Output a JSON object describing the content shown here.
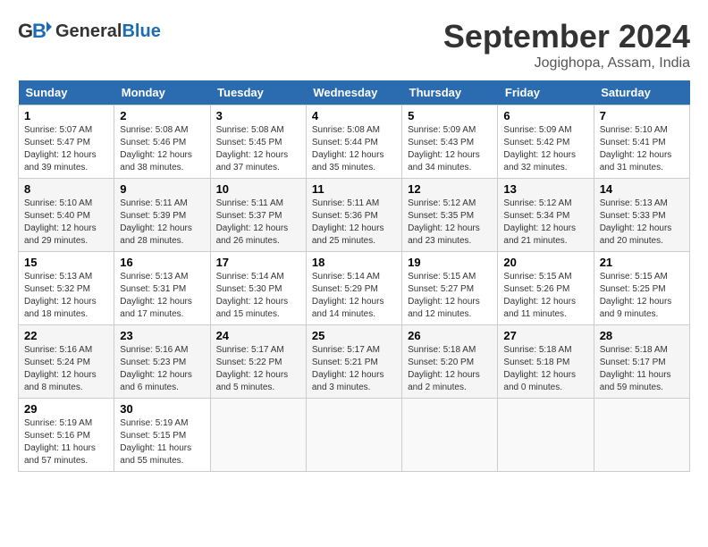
{
  "header": {
    "logo_line1": "General",
    "logo_line2": "Blue",
    "month": "September 2024",
    "location": "Jogighopa, Assam, India"
  },
  "weekdays": [
    "Sunday",
    "Monday",
    "Tuesday",
    "Wednesday",
    "Thursday",
    "Friday",
    "Saturday"
  ],
  "weeks": [
    [
      {
        "day": "1",
        "info": "Sunrise: 5:07 AM\nSunset: 5:47 PM\nDaylight: 12 hours\nand 39 minutes."
      },
      {
        "day": "2",
        "info": "Sunrise: 5:08 AM\nSunset: 5:46 PM\nDaylight: 12 hours\nand 38 minutes."
      },
      {
        "day": "3",
        "info": "Sunrise: 5:08 AM\nSunset: 5:45 PM\nDaylight: 12 hours\nand 37 minutes."
      },
      {
        "day": "4",
        "info": "Sunrise: 5:08 AM\nSunset: 5:44 PM\nDaylight: 12 hours\nand 35 minutes."
      },
      {
        "day": "5",
        "info": "Sunrise: 5:09 AM\nSunset: 5:43 PM\nDaylight: 12 hours\nand 34 minutes."
      },
      {
        "day": "6",
        "info": "Sunrise: 5:09 AM\nSunset: 5:42 PM\nDaylight: 12 hours\nand 32 minutes."
      },
      {
        "day": "7",
        "info": "Sunrise: 5:10 AM\nSunset: 5:41 PM\nDaylight: 12 hours\nand 31 minutes."
      }
    ],
    [
      {
        "day": "8",
        "info": "Sunrise: 5:10 AM\nSunset: 5:40 PM\nDaylight: 12 hours\nand 29 minutes."
      },
      {
        "day": "9",
        "info": "Sunrise: 5:11 AM\nSunset: 5:39 PM\nDaylight: 12 hours\nand 28 minutes."
      },
      {
        "day": "10",
        "info": "Sunrise: 5:11 AM\nSunset: 5:37 PM\nDaylight: 12 hours\nand 26 minutes."
      },
      {
        "day": "11",
        "info": "Sunrise: 5:11 AM\nSunset: 5:36 PM\nDaylight: 12 hours\nand 25 minutes."
      },
      {
        "day": "12",
        "info": "Sunrise: 5:12 AM\nSunset: 5:35 PM\nDaylight: 12 hours\nand 23 minutes."
      },
      {
        "day": "13",
        "info": "Sunrise: 5:12 AM\nSunset: 5:34 PM\nDaylight: 12 hours\nand 21 minutes."
      },
      {
        "day": "14",
        "info": "Sunrise: 5:13 AM\nSunset: 5:33 PM\nDaylight: 12 hours\nand 20 minutes."
      }
    ],
    [
      {
        "day": "15",
        "info": "Sunrise: 5:13 AM\nSunset: 5:32 PM\nDaylight: 12 hours\nand 18 minutes."
      },
      {
        "day": "16",
        "info": "Sunrise: 5:13 AM\nSunset: 5:31 PM\nDaylight: 12 hours\nand 17 minutes."
      },
      {
        "day": "17",
        "info": "Sunrise: 5:14 AM\nSunset: 5:30 PM\nDaylight: 12 hours\nand 15 minutes."
      },
      {
        "day": "18",
        "info": "Sunrise: 5:14 AM\nSunset: 5:29 PM\nDaylight: 12 hours\nand 14 minutes."
      },
      {
        "day": "19",
        "info": "Sunrise: 5:15 AM\nSunset: 5:27 PM\nDaylight: 12 hours\nand 12 minutes."
      },
      {
        "day": "20",
        "info": "Sunrise: 5:15 AM\nSunset: 5:26 PM\nDaylight: 12 hours\nand 11 minutes."
      },
      {
        "day": "21",
        "info": "Sunrise: 5:15 AM\nSunset: 5:25 PM\nDaylight: 12 hours\nand 9 minutes."
      }
    ],
    [
      {
        "day": "22",
        "info": "Sunrise: 5:16 AM\nSunset: 5:24 PM\nDaylight: 12 hours\nand 8 minutes."
      },
      {
        "day": "23",
        "info": "Sunrise: 5:16 AM\nSunset: 5:23 PM\nDaylight: 12 hours\nand 6 minutes."
      },
      {
        "day": "24",
        "info": "Sunrise: 5:17 AM\nSunset: 5:22 PM\nDaylight: 12 hours\nand 5 minutes."
      },
      {
        "day": "25",
        "info": "Sunrise: 5:17 AM\nSunset: 5:21 PM\nDaylight: 12 hours\nand 3 minutes."
      },
      {
        "day": "26",
        "info": "Sunrise: 5:18 AM\nSunset: 5:20 PM\nDaylight: 12 hours\nand 2 minutes."
      },
      {
        "day": "27",
        "info": "Sunrise: 5:18 AM\nSunset: 5:18 PM\nDaylight: 12 hours\nand 0 minutes."
      },
      {
        "day": "28",
        "info": "Sunrise: 5:18 AM\nSunset: 5:17 PM\nDaylight: 11 hours\nand 59 minutes."
      }
    ],
    [
      {
        "day": "29",
        "info": "Sunrise: 5:19 AM\nSunset: 5:16 PM\nDaylight: 11 hours\nand 57 minutes."
      },
      {
        "day": "30",
        "info": "Sunrise: 5:19 AM\nSunset: 5:15 PM\nDaylight: 11 hours\nand 55 minutes."
      },
      {
        "day": "",
        "info": ""
      },
      {
        "day": "",
        "info": ""
      },
      {
        "day": "",
        "info": ""
      },
      {
        "day": "",
        "info": ""
      },
      {
        "day": "",
        "info": ""
      }
    ]
  ]
}
